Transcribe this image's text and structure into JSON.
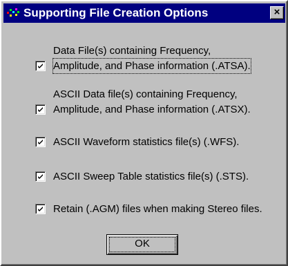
{
  "window": {
    "title": "Supporting File Creation Options",
    "close_glyph": "×",
    "icon": "app-icon"
  },
  "options": [
    {
      "line1": "Data File(s) containing Frequency,",
      "line2": "Amplitude, and Phase information (.ATSA).",
      "checked": true
    },
    {
      "line1": "ASCII Data file(s) containing Frequency,",
      "line2": "Amplitude, and Phase information (.ATSX).",
      "checked": true
    },
    {
      "line1": "ASCII Waveform statistics file(s) (.WFS).",
      "checked": true
    },
    {
      "line1": "ASCII Sweep Table statistics file(s) (.STS).",
      "checked": true
    },
    {
      "line1": "Retain (.AGM) files when making Stereo files.",
      "checked": true
    }
  ],
  "buttons": {
    "ok_label": "OK"
  }
}
